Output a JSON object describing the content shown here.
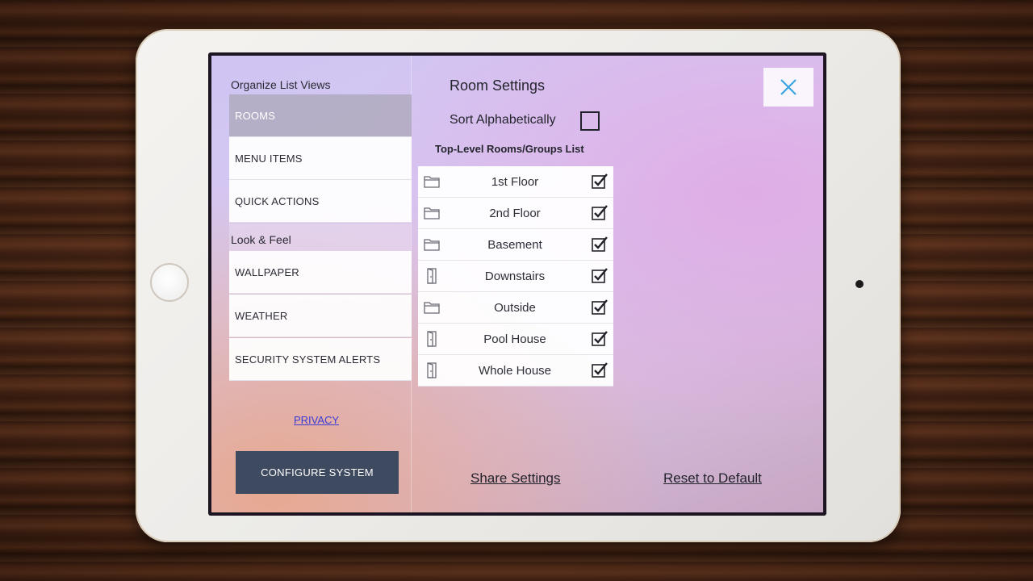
{
  "sidebar": {
    "organize_title": "Organize List Views",
    "organize_items": [
      {
        "label": "ROOMS"
      },
      {
        "label": "MENU ITEMS"
      },
      {
        "label": "QUICK ACTIONS"
      }
    ],
    "lookfeel_title": "Look & Feel",
    "lookfeel_items": [
      {
        "label": "WALLPAPER"
      },
      {
        "label": "WEATHER"
      },
      {
        "label": "SECURITY SYSTEM ALERTS"
      }
    ],
    "active_item": "ROOMS",
    "privacy_link": "PRIVACY",
    "configure_button": "CONFIGURE SYSTEM"
  },
  "main": {
    "title": "Room Settings",
    "sort_label": "Sort Alphabetically",
    "sort_checked": false,
    "list_title": "Top-Level Rooms/Groups List",
    "rooms": [
      {
        "name": "1st Floor",
        "icon": "folder-icon",
        "checked": true
      },
      {
        "name": "2nd Floor",
        "icon": "folder-icon",
        "checked": true
      },
      {
        "name": "Basement",
        "icon": "folder-icon",
        "checked": true
      },
      {
        "name": "Downstairs",
        "icon": "door-icon",
        "checked": true
      },
      {
        "name": "Outside",
        "icon": "folder-icon",
        "checked": true
      },
      {
        "name": "Pool House",
        "icon": "door-icon",
        "checked": true
      },
      {
        "name": "Whole House",
        "icon": "door-icon",
        "checked": true
      }
    ],
    "share_link": "Share Settings",
    "reset_link": "Reset to Default",
    "close_icon": "close-icon"
  },
  "colors": {
    "accent_close": "#3aa4e0",
    "config_button_bg": "#3e4a5f",
    "active_nav_bg": "#afaabe",
    "privacy_link": "#3b3bd6"
  }
}
